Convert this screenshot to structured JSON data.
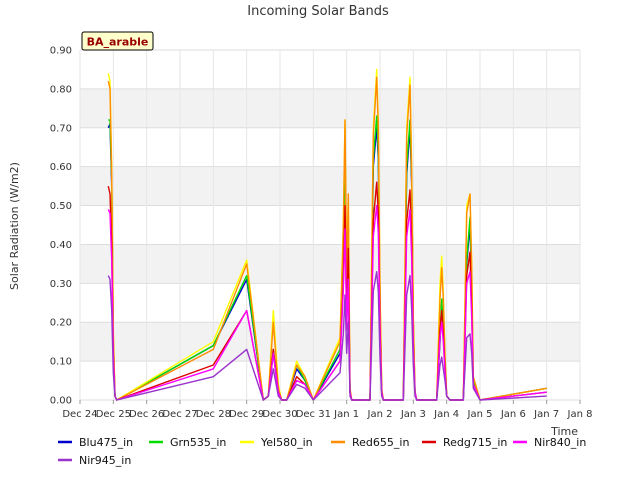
{
  "chart_data": {
    "type": "line",
    "title": "Incoming Solar Bands",
    "xlabel": "Time",
    "ylabel": "Solar Radiation (W/m2)",
    "site_badge": "BA_arable",
    "ylim": [
      0,
      0.9
    ],
    "y_ticks": [
      "0.00",
      "0.10",
      "0.20",
      "0.30",
      "0.40",
      "0.50",
      "0.60",
      "0.70",
      "0.80",
      "0.90"
    ],
    "xlim": [
      0,
      15
    ],
    "x_ticks": [
      "Dec 24",
      "Dec 25",
      "Dec 26",
      "Dec 27",
      "Dec 28",
      "Dec 29",
      "Dec 30",
      "Dec 31",
      "Jan 1",
      "Jan 2",
      "Jan 3",
      "Jan 4",
      "Jan 5",
      "Jan 6",
      "Jan 7",
      "Jan 8"
    ],
    "x_unit": "days since Dec 24",
    "grid": true,
    "legend_position": "bottom",
    "series": [
      {
        "name": "Blu475_in",
        "color": "#0000cc",
        "x": [
          0.85,
          0.9,
          0.95,
          1.0,
          1.05,
          1.1,
          4.0,
          5.0,
          5.5,
          5.65,
          5.8,
          5.95,
          6.05,
          6.2,
          6.5,
          6.75,
          7.0,
          7.8,
          7.9,
          7.95,
          8.0,
          8.05,
          8.1,
          8.15,
          8.3,
          8.7,
          8.8,
          8.9,
          8.95,
          9.0,
          9.05,
          9.1,
          9.3,
          9.7,
          9.8,
          9.9,
          9.95,
          10.0,
          10.05,
          10.1,
          10.3,
          10.7,
          10.8,
          10.85,
          10.9,
          10.95,
          11.0,
          11.1,
          11.5,
          11.6,
          11.7,
          11.75,
          11.8,
          12.0,
          14.0
        ],
        "y": [
          0.7,
          0.71,
          0.55,
          0.15,
          0.01,
          0.0,
          0.14,
          0.31,
          0.0,
          0.01,
          0.12,
          0.02,
          0.0,
          0.0,
          0.08,
          0.05,
          0.0,
          0.12,
          0.38,
          0.6,
          0.25,
          0.32,
          0.02,
          0.0,
          0.0,
          0.0,
          0.6,
          0.7,
          0.62,
          0.25,
          0.02,
          0.0,
          0.0,
          0.0,
          0.58,
          0.7,
          0.55,
          0.2,
          0.02,
          0.0,
          0.0,
          0.0,
          0.15,
          0.25,
          0.18,
          0.1,
          0.01,
          0.0,
          0.0,
          0.35,
          0.45,
          0.3,
          0.05,
          0.0,
          0.03
        ]
      },
      {
        "name": "Grn535_in",
        "color": "#00dd00",
        "x": [
          0.85,
          0.9,
          0.95,
          1.0,
          1.05,
          1.1,
          4.0,
          5.0,
          5.5,
          5.65,
          5.8,
          5.95,
          6.05,
          6.2,
          6.5,
          6.75,
          7.0,
          7.8,
          7.9,
          7.95,
          8.0,
          8.05,
          8.1,
          8.15,
          8.3,
          8.7,
          8.8,
          8.9,
          8.95,
          9.0,
          9.05,
          9.1,
          9.3,
          9.7,
          9.8,
          9.9,
          9.95,
          10.0,
          10.05,
          10.1,
          10.3,
          10.7,
          10.8,
          10.85,
          10.9,
          10.95,
          11.0,
          11.1,
          11.5,
          11.6,
          11.7,
          11.75,
          11.8,
          12.0,
          14.0
        ],
        "y": [
          0.72,
          0.72,
          0.57,
          0.15,
          0.01,
          0.0,
          0.14,
          0.32,
          0.0,
          0.01,
          0.13,
          0.02,
          0.0,
          0.0,
          0.09,
          0.05,
          0.0,
          0.13,
          0.4,
          0.62,
          0.26,
          0.33,
          0.02,
          0.0,
          0.0,
          0.0,
          0.62,
          0.73,
          0.64,
          0.26,
          0.02,
          0.0,
          0.0,
          0.0,
          0.6,
          0.72,
          0.57,
          0.2,
          0.02,
          0.0,
          0.0,
          0.0,
          0.16,
          0.26,
          0.19,
          0.1,
          0.01,
          0.0,
          0.0,
          0.36,
          0.47,
          0.31,
          0.05,
          0.0,
          0.03
        ]
      },
      {
        "name": "Yel580_in",
        "color": "#ffff00",
        "x": [
          0.85,
          0.9,
          0.95,
          1.0,
          1.05,
          1.1,
          4.0,
          5.0,
          5.5,
          5.65,
          5.8,
          5.95,
          6.05,
          6.2,
          6.5,
          6.75,
          7.0,
          7.8,
          7.9,
          7.95,
          8.0,
          8.05,
          8.1,
          8.15,
          8.3,
          8.7,
          8.8,
          8.9,
          8.95,
          9.0,
          9.05,
          9.1,
          9.3,
          9.7,
          9.8,
          9.9,
          9.95,
          10.0,
          10.05,
          10.1,
          10.3,
          10.7,
          10.8,
          10.85,
          10.9,
          10.95,
          11.0,
          11.1,
          11.5,
          11.6,
          11.7,
          11.75,
          11.8,
          12.0,
          14.0
        ],
        "y": [
          0.84,
          0.82,
          0.6,
          0.18,
          0.01,
          0.0,
          0.15,
          0.36,
          0.0,
          0.01,
          0.23,
          0.04,
          0.0,
          0.0,
          0.1,
          0.06,
          0.0,
          0.16,
          0.45,
          0.72,
          0.3,
          0.53,
          0.03,
          0.0,
          0.0,
          0.0,
          0.7,
          0.85,
          0.72,
          0.3,
          0.03,
          0.0,
          0.0,
          0.0,
          0.7,
          0.83,
          0.6,
          0.22,
          0.02,
          0.0,
          0.0,
          0.0,
          0.3,
          0.37,
          0.28,
          0.12,
          0.01,
          0.0,
          0.0,
          0.5,
          0.53,
          0.35,
          0.06,
          0.0,
          0.03
        ]
      },
      {
        "name": "Red655_in",
        "color": "#ff8c00",
        "x": [
          0.85,
          0.9,
          0.95,
          1.0,
          1.05,
          1.1,
          4.0,
          5.0,
          5.5,
          5.65,
          5.8,
          5.95,
          6.05,
          6.2,
          6.5,
          6.75,
          7.0,
          7.8,
          7.9,
          7.95,
          8.0,
          8.05,
          8.1,
          8.15,
          8.3,
          8.7,
          8.8,
          8.9,
          8.95,
          9.0,
          9.05,
          9.1,
          9.3,
          9.7,
          9.8,
          9.9,
          9.95,
          10.0,
          10.05,
          10.1,
          10.3,
          10.7,
          10.8,
          10.85,
          10.9,
          10.95,
          11.0,
          11.1,
          11.5,
          11.6,
          11.7,
          11.75,
          11.8,
          12.0,
          14.0
        ],
        "y": [
          0.82,
          0.8,
          0.58,
          0.17,
          0.01,
          0.0,
          0.13,
          0.35,
          0.0,
          0.01,
          0.2,
          0.03,
          0.0,
          0.0,
          0.09,
          0.06,
          0.0,
          0.15,
          0.44,
          0.72,
          0.3,
          0.53,
          0.03,
          0.0,
          0.0,
          0.0,
          0.68,
          0.83,
          0.7,
          0.28,
          0.03,
          0.0,
          0.0,
          0.0,
          0.68,
          0.81,
          0.58,
          0.21,
          0.02,
          0.0,
          0.0,
          0.0,
          0.26,
          0.34,
          0.26,
          0.11,
          0.01,
          0.0,
          0.0,
          0.48,
          0.53,
          0.34,
          0.06,
          0.0,
          0.03
        ]
      },
      {
        "name": "Redg715_in",
        "color": "#dd0000",
        "x": [
          0.85,
          0.9,
          0.95,
          1.0,
          1.05,
          1.1,
          4.0,
          5.0,
          5.5,
          5.65,
          5.8,
          5.95,
          6.05,
          6.2,
          6.5,
          6.75,
          7.0,
          7.8,
          7.9,
          7.95,
          8.0,
          8.05,
          8.1,
          8.15,
          8.3,
          8.7,
          8.8,
          8.9,
          8.95,
          9.0,
          9.05,
          9.1,
          9.3,
          9.7,
          9.8,
          9.9,
          9.95,
          10.0,
          10.05,
          10.1,
          10.3,
          10.7,
          10.8,
          10.85,
          10.9,
          10.95,
          11.0,
          11.1,
          11.5,
          11.6,
          11.7,
          11.75,
          11.8,
          12.0,
          14.0
        ],
        "y": [
          0.55,
          0.53,
          0.4,
          0.12,
          0.01,
          0.0,
          0.09,
          0.23,
          0.0,
          0.01,
          0.13,
          0.02,
          0.0,
          0.0,
          0.06,
          0.04,
          0.0,
          0.1,
          0.3,
          0.5,
          0.2,
          0.39,
          0.02,
          0.0,
          0.0,
          0.0,
          0.46,
          0.56,
          0.48,
          0.19,
          0.02,
          0.0,
          0.0,
          0.0,
          0.46,
          0.54,
          0.4,
          0.14,
          0.02,
          0.0,
          0.0,
          0.0,
          0.18,
          0.23,
          0.17,
          0.08,
          0.01,
          0.0,
          0.0,
          0.32,
          0.38,
          0.23,
          0.04,
          0.0,
          0.02
        ]
      },
      {
        "name": "Nir840_in",
        "color": "#ff00ff",
        "x": [
          0.85,
          0.9,
          0.95,
          1.0,
          1.05,
          1.1,
          4.0,
          5.0,
          5.5,
          5.65,
          5.8,
          5.95,
          6.05,
          6.2,
          6.5,
          6.75,
          7.0,
          7.8,
          7.9,
          7.95,
          8.0,
          8.05,
          8.1,
          8.15,
          8.3,
          8.7,
          8.8,
          8.9,
          8.95,
          9.0,
          9.05,
          9.1,
          9.3,
          9.7,
          9.8,
          9.9,
          9.95,
          10.0,
          10.05,
          10.1,
          10.3,
          10.7,
          10.8,
          10.85,
          10.9,
          10.95,
          11.0,
          11.1,
          11.5,
          11.6,
          11.7,
          11.75,
          11.8,
          12.0,
          14.0
        ],
        "y": [
          0.49,
          0.48,
          0.36,
          0.11,
          0.01,
          0.0,
          0.08,
          0.23,
          0.0,
          0.01,
          0.12,
          0.02,
          0.0,
          0.0,
          0.05,
          0.04,
          0.0,
          0.1,
          0.28,
          0.44,
          0.18,
          0.31,
          0.02,
          0.0,
          0.0,
          0.0,
          0.42,
          0.5,
          0.43,
          0.17,
          0.02,
          0.0,
          0.0,
          0.0,
          0.42,
          0.49,
          0.36,
          0.13,
          0.02,
          0.0,
          0.0,
          0.0,
          0.16,
          0.2,
          0.15,
          0.07,
          0.01,
          0.0,
          0.0,
          0.3,
          0.33,
          0.21,
          0.04,
          0.0,
          0.02
        ]
      },
      {
        "name": "Nir945_in",
        "color": "#9933cc",
        "x": [
          0.85,
          0.9,
          0.95,
          1.0,
          1.05,
          1.1,
          4.0,
          5.0,
          5.5,
          5.65,
          5.8,
          5.95,
          6.05,
          6.2,
          6.5,
          6.75,
          7.0,
          7.8,
          7.9,
          7.95,
          8.0,
          8.05,
          8.1,
          8.15,
          8.3,
          8.7,
          8.8,
          8.9,
          8.95,
          9.0,
          9.05,
          9.1,
          9.3,
          9.7,
          9.8,
          9.9,
          9.95,
          10.0,
          10.05,
          10.1,
          10.3,
          10.7,
          10.8,
          10.85,
          10.9,
          10.95,
          11.0,
          11.1,
          11.5,
          11.6,
          11.7,
          11.75,
          11.8,
          12.0,
          14.0
        ],
        "y": [
          0.32,
          0.31,
          0.23,
          0.07,
          0.01,
          0.0,
          0.06,
          0.13,
          0.0,
          0.01,
          0.08,
          0.01,
          0.0,
          0.0,
          0.04,
          0.03,
          0.0,
          0.07,
          0.17,
          0.27,
          0.12,
          0.2,
          0.01,
          0.0,
          0.0,
          0.0,
          0.28,
          0.33,
          0.28,
          0.11,
          0.01,
          0.0,
          0.0,
          0.0,
          0.27,
          0.32,
          0.23,
          0.09,
          0.01,
          0.0,
          0.0,
          0.0,
          0.09,
          0.11,
          0.08,
          0.05,
          0.01,
          0.0,
          0.0,
          0.16,
          0.17,
          0.12,
          0.03,
          0.0,
          0.01
        ]
      }
    ]
  }
}
